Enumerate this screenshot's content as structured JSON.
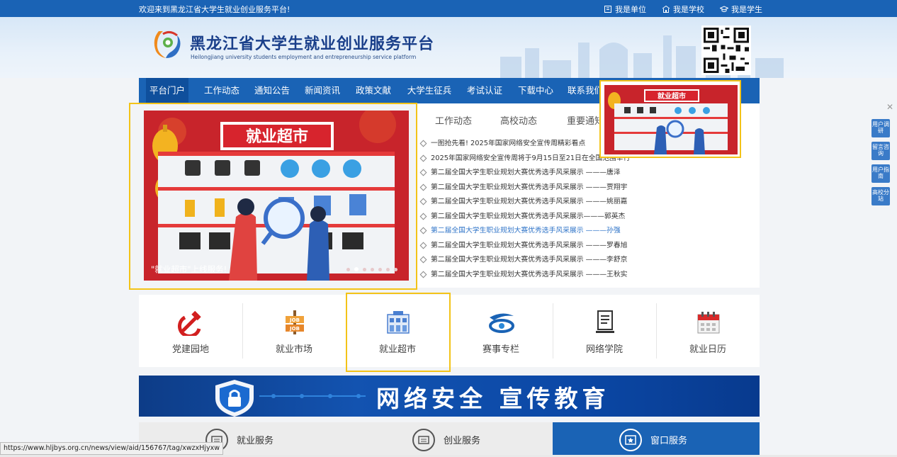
{
  "topbar": {
    "welcome": "欢迎来到黑龙江省大学生就业创业服务平台!",
    "links": [
      "我是单位",
      "我是学校",
      "我是学生"
    ]
  },
  "header": {
    "title": "黑龙江省大学生就业创业服务平台",
    "subtitle": "Heilongjiang university students employment and entrepreneurship service platform"
  },
  "nav": [
    "平台门户",
    "工作动态",
    "通知公告",
    "新闻资讯",
    "政策文献",
    "大学生征兵",
    "考试认证",
    "下载中心",
    "联系我们"
  ],
  "banner": {
    "sign": "就业超市",
    "caption": "\"就业超市\"上线服务!",
    "slide_count": 7,
    "active_slide": 2
  },
  "popup": {
    "sign": "就业超市"
  },
  "news": {
    "tabs": [
      "工作动态",
      "高校动态",
      "重要通知"
    ],
    "items": [
      "一图抢先看! 2025年国家网络安全宣传周精彩看点",
      "2025年国家网络安全宣传周将于9月15日至21日在全国范围举行",
      "第二届全国大学生职业规划大赛优秀选手风采展示 ———唐泽",
      "第二届全国大学生职业规划大赛优秀选手风采展示 ———贾翔宇",
      "第二届全国大学生职业规划大赛优秀选手风采展示 ———姚丽嘉",
      "第二届全国大学生职业规划大赛优秀选手风采展示———郭英杰",
      "第二届全国大学生职业规划大赛优秀选手风采展示 ———孙强",
      "第二届全国大学生职业规划大赛优秀选手风采展示 ———罗春旭",
      "第二届全国大学生职业规划大赛优秀选手风采展示 ———李舒京",
      "第二届全国大学生职业规划大赛优秀选手风采展示 ———王秋实"
    ],
    "highlighted_index": 6
  },
  "side_buttons": [
    "用户调研",
    "留言咨询",
    "用户指南",
    "高校分站"
  ],
  "quick_links": [
    "党建园地",
    "就业市场",
    "就业超市",
    "赛事专栏",
    "网络学院",
    "就业日历"
  ],
  "promo": {
    "text": "网络安全  宣传教育"
  },
  "services": [
    "就业服务",
    "创业服务",
    "窗口服务"
  ],
  "status_url": "https://www.hljbys.org.cn/news/view/aid/156767/tag/xwzxHjyxw",
  "colors": {
    "primary": "#1a63b5",
    "highlight": "#f3c318",
    "banner_red": "#c8242b",
    "link_blue": "#2f74c8"
  }
}
